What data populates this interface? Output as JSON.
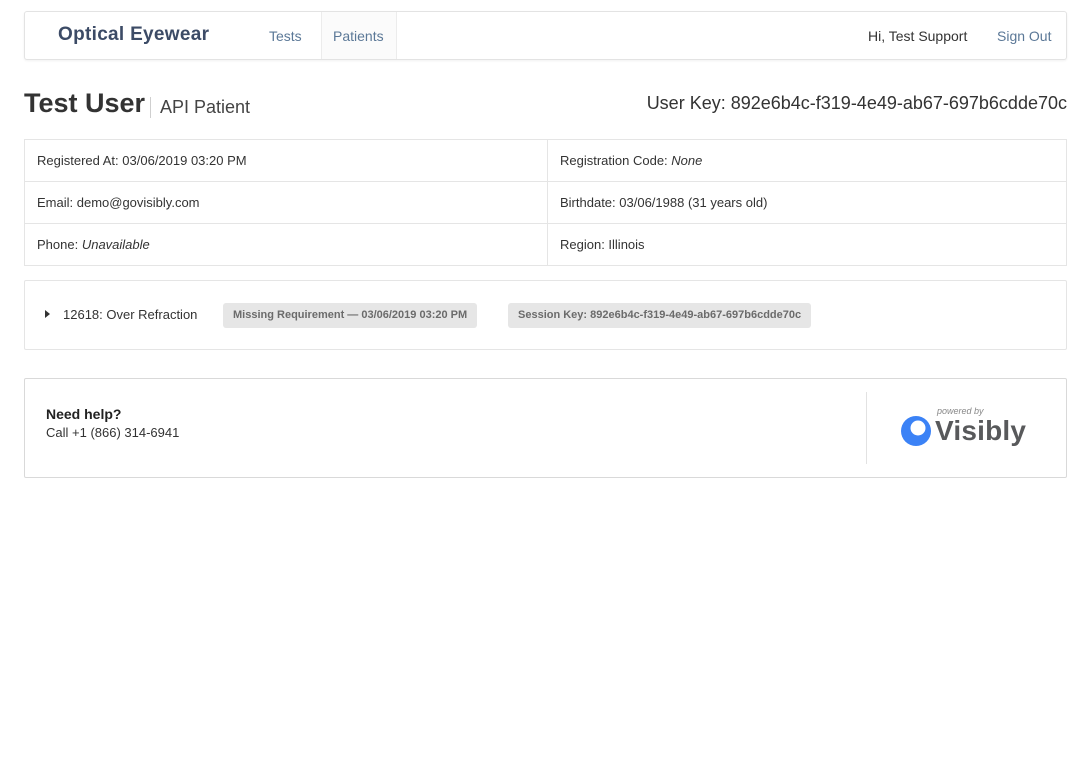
{
  "nav": {
    "brand": "Optical Eyewear",
    "links": [
      {
        "label": "Tests"
      },
      {
        "label": "Patients"
      }
    ],
    "greeting": "Hi, Test Support",
    "sign_out": "Sign Out"
  },
  "header": {
    "name": "Test User",
    "subtitle": "API Patient",
    "user_key": "User Key: 892e6b4c-f319-4e49-ab67-697b6cdde70c"
  },
  "info": {
    "registered_label": "Registered At: ",
    "registered_value": "03/06/2019 03:20 PM",
    "reg_code_label": "Registration Code: ",
    "reg_code_value": "None",
    "email_label": "Email: ",
    "email_value": "demo@govisibly.com",
    "birthdate_label": "Birthdate: ",
    "birthdate_value": "03/06/1988 (31 years old)",
    "phone_label": "Phone: ",
    "phone_value": "Unavailable",
    "region_label": "Region: ",
    "region_value": "Illinois"
  },
  "session": {
    "title": "12618: Over Refraction",
    "status_badge": "Missing Requirement — 03/06/2019 03:20 PM",
    "session_key_badge": "Session Key: 892e6b4c-f319-4e49-ab67-697b6cdde70c"
  },
  "help": {
    "title": "Need help?",
    "phone": "Call +1 (866) 314-6941",
    "powered_by": "powered by",
    "logo_text": "Visibly",
    "logo_icon": "visibly-logo-icon",
    "logo_color": "#3b82f6"
  },
  "colors": {
    "brand": "#3c4b66",
    "link": "#5b7897",
    "badge_bg": "#e6e6e6",
    "badge_text": "#6b6b6b"
  }
}
